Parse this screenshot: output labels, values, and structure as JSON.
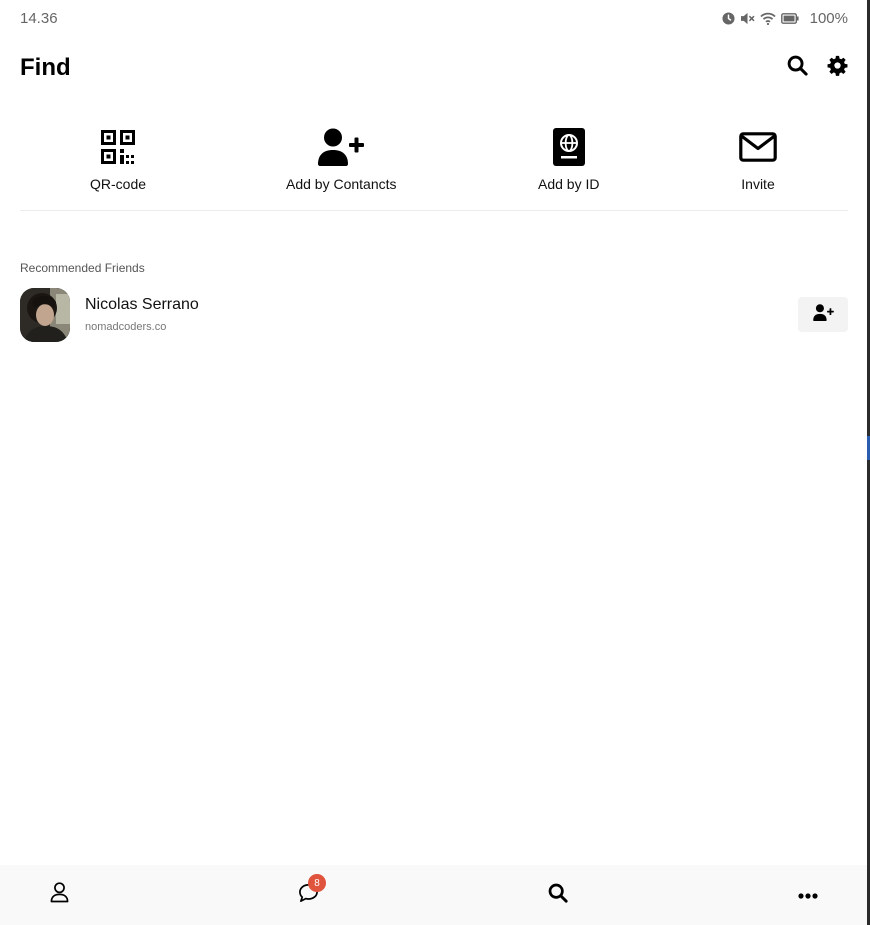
{
  "status_bar": {
    "time": "14.36",
    "battery": "100%",
    "icons": [
      "alarm-icon",
      "mute-icon",
      "wifi-icon",
      "battery-icon"
    ]
  },
  "header": {
    "title": "Find",
    "actions": [
      "search-icon",
      "gear-icon"
    ]
  },
  "quick_actions": [
    {
      "label": "QR-code",
      "icon": "qr-code-icon"
    },
    {
      "label": "Add by Contancts",
      "icon": "add-user-icon"
    },
    {
      "label": "Add by ID",
      "icon": "passport-icon"
    },
    {
      "label": "Invite",
      "icon": "envelope-icon"
    }
  ],
  "recommended": {
    "section_label": "Recommended Friends",
    "friends": [
      {
        "name": "Nicolas Serrano",
        "subtitle": "nomadcoders.co",
        "action_icon": "add-user-icon"
      }
    ]
  },
  "bottom_nav": {
    "items": [
      {
        "icon": "user-icon"
      },
      {
        "icon": "chat-icon",
        "badge": "8"
      },
      {
        "icon": "search-icon"
      },
      {
        "icon": "more-icon"
      }
    ]
  },
  "colors": {
    "badge": "#e0533c",
    "nav_background": "#f9f9f9",
    "button_background": "#f3f3f3"
  }
}
